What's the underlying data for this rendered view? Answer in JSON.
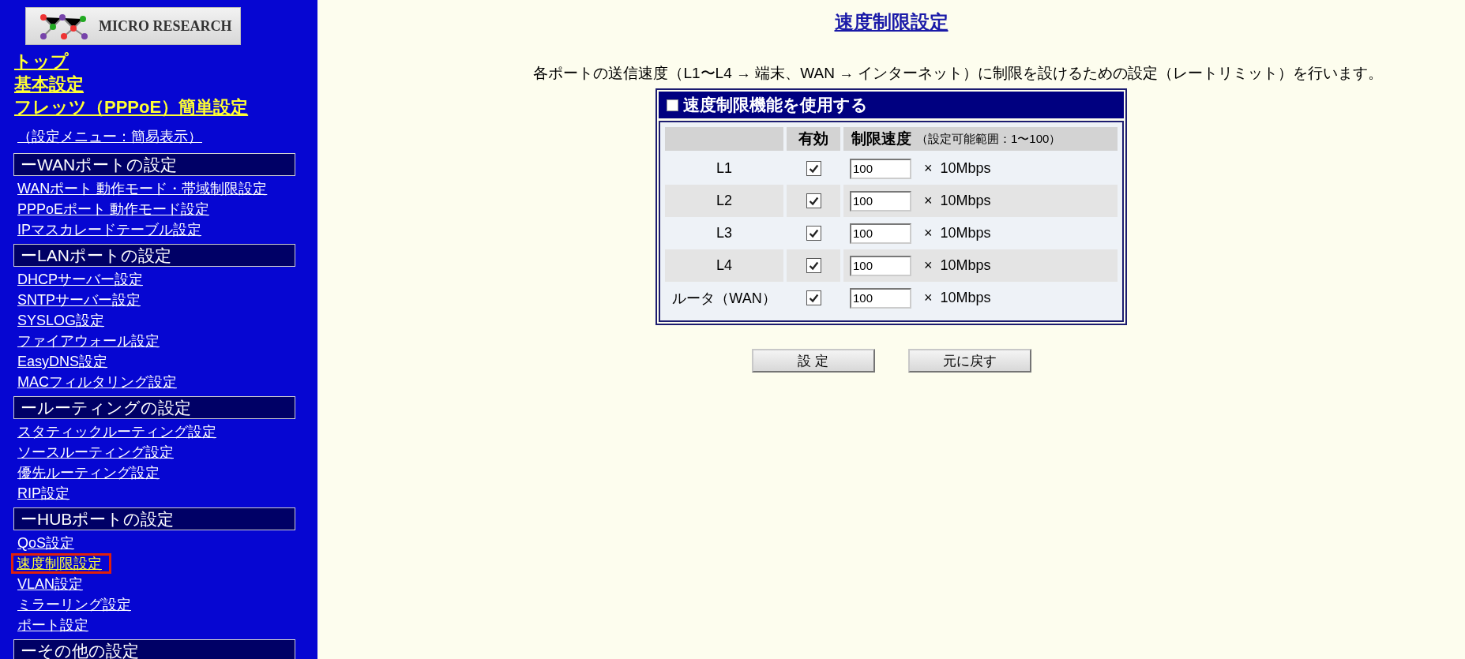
{
  "sidebar": {
    "logo_text": "MICRO RESEARCH",
    "top_links": [
      "トップ",
      "基本設定",
      "フレッツ（PPPoE）簡単設定"
    ],
    "menu_mode_link": "（設定メニュー：簡易表示）",
    "sections": [
      {
        "title": "ーWANポートの設定",
        "items": [
          {
            "label": "WANポート 動作モード・帯域制限設定",
            "selected": false
          },
          {
            "label": "PPPoEポート 動作モード設定",
            "selected": false
          },
          {
            "label": "IPマスカレードテーブル設定",
            "selected": false
          }
        ]
      },
      {
        "title": "ーLANポートの設定",
        "items": [
          {
            "label": "DHCPサーバー設定",
            "selected": false
          },
          {
            "label": "SNTPサーバー設定",
            "selected": false
          },
          {
            "label": "SYSLOG設定",
            "selected": false
          },
          {
            "label": "ファイアウォール設定",
            "selected": false
          },
          {
            "label": "EasyDNS設定",
            "selected": false
          },
          {
            "label": "MACフィルタリング設定",
            "selected": false
          }
        ]
      },
      {
        "title": "ールーティングの設定",
        "items": [
          {
            "label": "スタティックルーティング設定",
            "selected": false
          },
          {
            "label": "ソースルーティング設定",
            "selected": false
          },
          {
            "label": "優先ルーティング設定",
            "selected": false
          },
          {
            "label": "RIP設定",
            "selected": false
          }
        ]
      },
      {
        "title": "ーHUBポートの設定",
        "items": [
          {
            "label": "QoS設定",
            "selected": false
          },
          {
            "label": "速度制限設定",
            "selected": true
          },
          {
            "label": "VLAN設定",
            "selected": false
          },
          {
            "label": "ミラーリング設定",
            "selected": false
          },
          {
            "label": "ポート設定",
            "selected": false
          }
        ]
      },
      {
        "title": "ーその他の設定"
      }
    ]
  },
  "main": {
    "title": "速度制限設定",
    "description": "各ポートの送信速度（L1〜L4 → 端末、WAN → インターネット）に制限を設けるための設定（レートリミット）を行います。",
    "panel": {
      "enable_label": "速度制限機能を使用する",
      "enabled": false,
      "columns": {
        "enabled": "有効",
        "speed": "制限速度",
        "speed_note": "（設定可能範囲：1〜100）"
      },
      "rows": [
        {
          "port": "L1",
          "checked": true,
          "value": "100",
          "unit": "×  10Mbps"
        },
        {
          "port": "L2",
          "checked": true,
          "value": "100",
          "unit": "×  10Mbps"
        },
        {
          "port": "L3",
          "checked": true,
          "value": "100",
          "unit": "×  10Mbps"
        },
        {
          "port": "L4",
          "checked": true,
          "value": "100",
          "unit": "×  10Mbps"
        },
        {
          "port": "ルータ（WAN）",
          "checked": true,
          "value": "100",
          "unit": "×  10Mbps"
        }
      ]
    },
    "buttons": [
      "設 定",
      "元に戻す"
    ]
  }
}
